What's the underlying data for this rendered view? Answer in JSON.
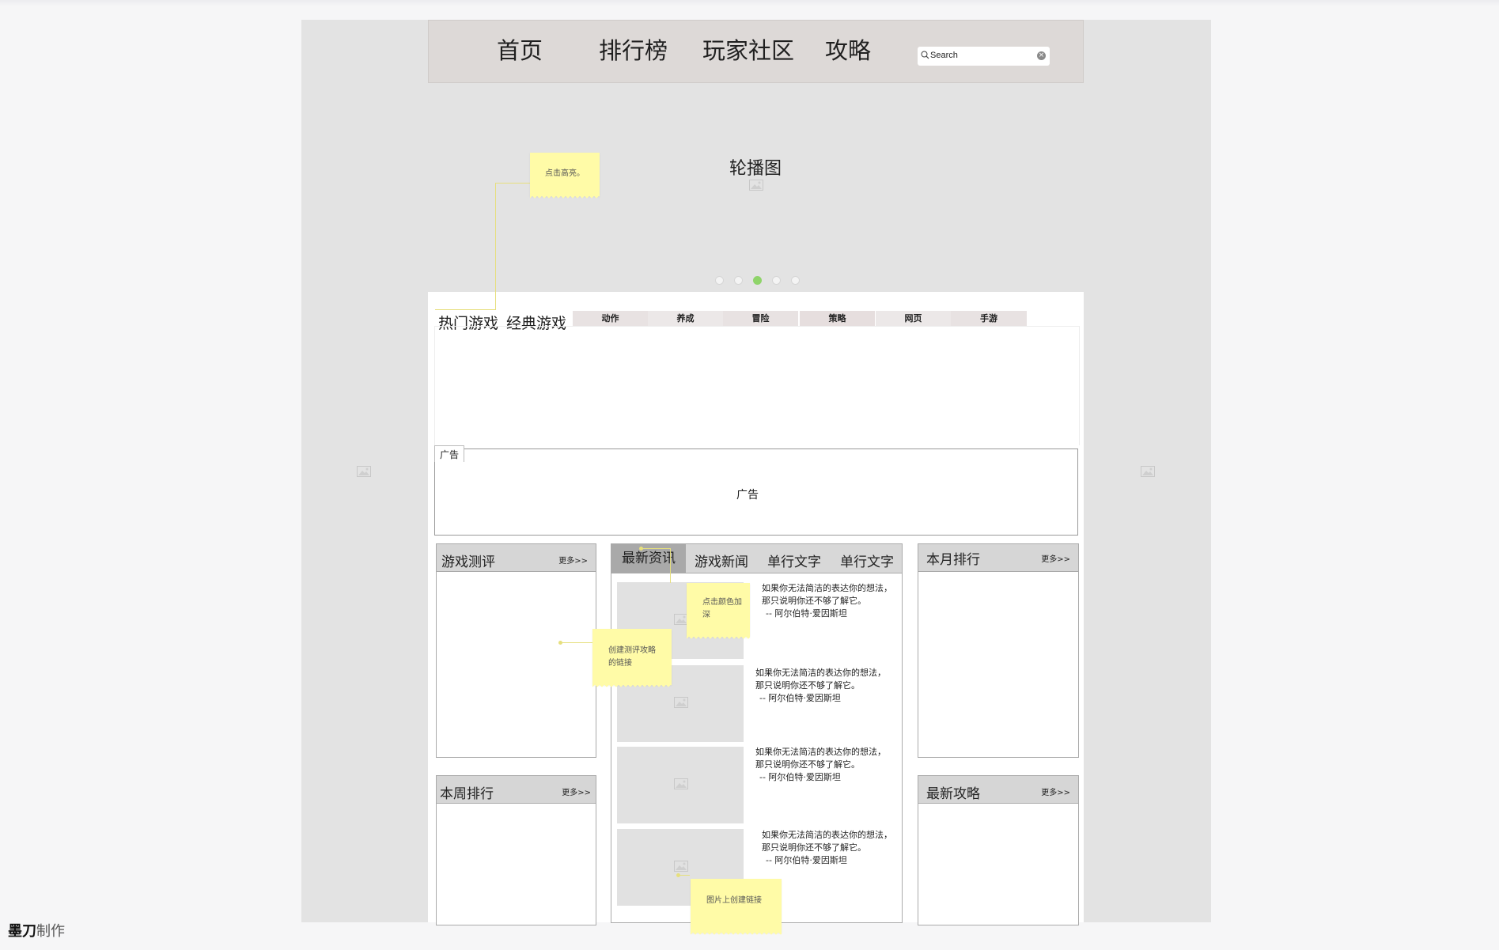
{
  "nav": {
    "items": [
      "首页",
      "排行榜",
      "玩家社区",
      "攻略"
    ]
  },
  "search": {
    "placeholder": "Search"
  },
  "carousel": {
    "title": "轮播图",
    "dots": 5,
    "active_dot": 3
  },
  "games": {
    "tabs": [
      "热门游戏",
      "经典游戏"
    ],
    "categories": [
      "动作",
      "养成",
      "冒险",
      "策略",
      "网页",
      "手游"
    ]
  },
  "ad": {
    "tab_label": "广告",
    "label": "广告"
  },
  "review": {
    "title": "游戏测评",
    "more": "更多>>"
  },
  "weekly": {
    "title": "本周排行",
    "more": "更多>>"
  },
  "news": {
    "tabs": [
      "最新资讯",
      "游戏新闻",
      "单行文字",
      "单行文字"
    ],
    "items": [
      {
        "text": "如果你无法简洁的表达你的想法，那只说明你还不够了解它。",
        "author": "-- 阿尔伯特·爱因斯坦"
      },
      {
        "text": "如果你无法简洁的表达你的想法，那只说明你还不够了解它。",
        "author": "-- 阿尔伯特·爱因斯坦"
      },
      {
        "text": "如果你无法简洁的表达你的想法，那只说明你还不够了解它。",
        "author": "-- 阿尔伯特·爱因斯坦"
      },
      {
        "text": "如果你无法简洁的表达你的想法，那只说明你还不够了解它。",
        "author": "-- 阿尔伯特·爱因斯坦"
      }
    ]
  },
  "monthly": {
    "title": "本月排行",
    "more": "更多>>"
  },
  "guides": {
    "title": "最新攻略",
    "more": "更多>>"
  },
  "notes": {
    "highlight": "点击高亮。",
    "darken": "点击颜色加深",
    "review_link": "创建测评攻略的链接",
    "image_link": "图片上创建链接"
  },
  "brand": {
    "mark": "墨刀",
    "suffix": "制作"
  },
  "colors": {
    "active_dot": "#8fd46a",
    "sticky": "#fffba7",
    "nav_bg": "#ddd9d7",
    "canvas": "#e3e3e3"
  }
}
